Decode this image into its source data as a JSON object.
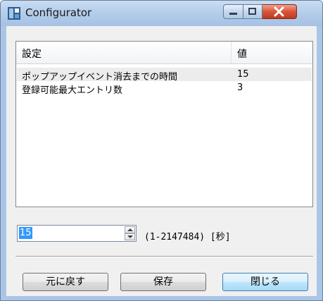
{
  "window": {
    "title": "Configurator",
    "accent_color": "#a9c6e8",
    "close_color": "#d9543a"
  },
  "list": {
    "headers": {
      "setting": "設定",
      "value": "値"
    },
    "rows": [
      {
        "setting": "ポップアップイベント消去までの時間",
        "value": "15",
        "selected": true
      },
      {
        "setting": "登録可能最大エントリ数",
        "value": "3",
        "selected": false
      }
    ]
  },
  "editor": {
    "value": "15",
    "range": "(1-2147484) [秒]"
  },
  "buttons": {
    "revert": "元に戻す",
    "save": "保存",
    "close": "閉じる"
  }
}
